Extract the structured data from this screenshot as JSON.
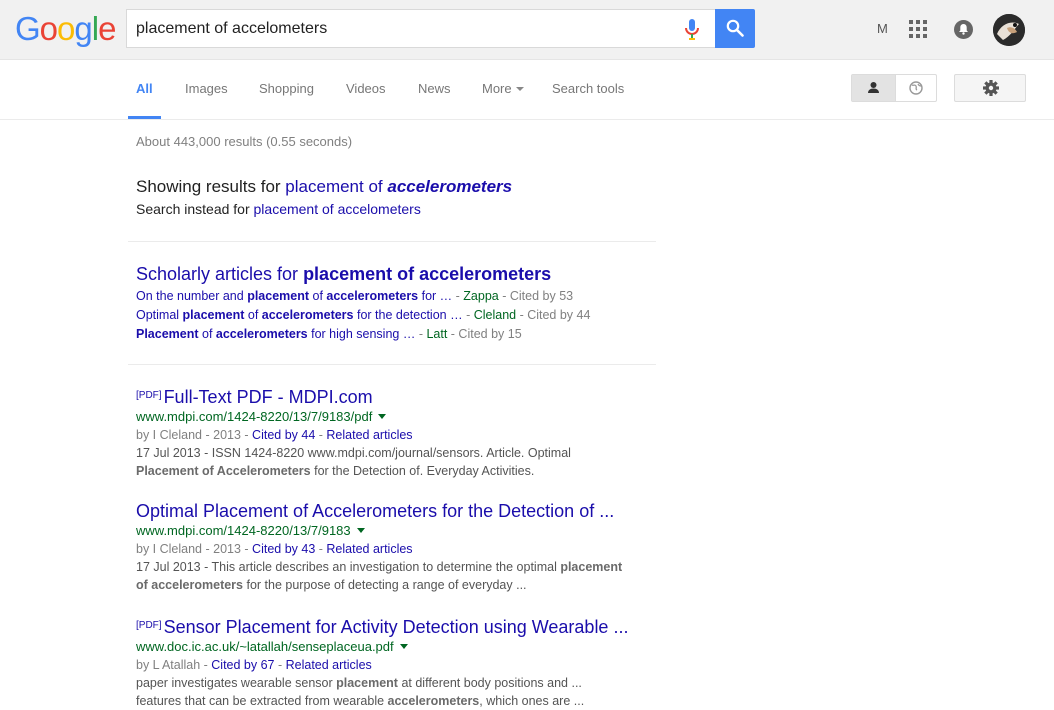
{
  "header": {
    "logo_letters": [
      {
        "ch": "G",
        "color": "#4285f4"
      },
      {
        "ch": "o",
        "color": "#ea4335"
      },
      {
        "ch": "o",
        "color": "#fbbc05"
      },
      {
        "ch": "g",
        "color": "#4285f4"
      },
      {
        "ch": "l",
        "color": "#34a853"
      },
      {
        "ch": "e",
        "color": "#ea4335"
      }
    ],
    "search_value": "placement of accelometers",
    "user_letter": "M"
  },
  "tabs": [
    {
      "label": "All",
      "active": true
    },
    {
      "label": "Images"
    },
    {
      "label": "Shopping"
    },
    {
      "label": "Videos"
    },
    {
      "label": "News"
    },
    {
      "label": "More"
    },
    {
      "label": "Search tools"
    }
  ],
  "stats": "About 443,000 results (0.55 seconds)",
  "correction": {
    "showing_prefix": "Showing results for ",
    "showing_plain": "placement of ",
    "showing_bold": "accelerometers",
    "instead_prefix": "Search instead for ",
    "instead_link": "placement of accelometers"
  },
  "scholarly": {
    "title_prefix": "Scholarly articles for ",
    "title_bold": "placement of accelerometers",
    "items": [
      {
        "parts": [
          [
            "On the number and ",
            false
          ],
          [
            "placement",
            true
          ],
          [
            " of ",
            false
          ],
          [
            "accelerometers",
            true
          ],
          [
            " for …",
            false
          ]
        ],
        "author": "Zappa",
        "cited": "Cited by 53"
      },
      {
        "parts": [
          [
            "Optimal ",
            false
          ],
          [
            "placement",
            true
          ],
          [
            " of ",
            false
          ],
          [
            "accelerometers",
            true
          ],
          [
            " for the detection …",
            false
          ]
        ],
        "author": "Cleland",
        "cited": "Cited by 44"
      },
      {
        "parts": [
          [
            "Placement",
            true
          ],
          [
            " of ",
            false
          ],
          [
            "accelerometers",
            true
          ],
          [
            " for high sensing …",
            false
          ]
        ],
        "author": "Latt",
        "cited": "Cited by 15"
      }
    ]
  },
  "results": [
    {
      "pdf": "[PDF]",
      "title": "Full-Text PDF - MDPI.com",
      "url": "www.mdpi.com/1424-8220/13/7/9183/pdf",
      "meta_prefix": "by I Cleland - 2013 - ",
      "cited": "Cited by 44",
      "related": "Related articles",
      "snippet1": [
        [
          "17 Jul 2013 - ",
          false
        ],
        [
          "ISSN 1424-8220 www.mdpi.com/journal/sensors. Article. Optimal",
          false
        ]
      ],
      "snippet2": [
        [
          "Placement of Accelerometers",
          true
        ],
        [
          " for the Detection of. Everyday Activities.",
          false
        ]
      ]
    },
    {
      "pdf": "",
      "title": "Optimal Placement of Accelerometers for the Detection of ...",
      "url": "www.mdpi.com/1424-8220/13/7/9183",
      "meta_prefix": "by I Cleland - 2013 - ",
      "cited": "Cited by 43",
      "related": "Related articles",
      "snippet1": [
        [
          "17 Jul 2013 - ",
          false
        ],
        [
          "This article describes an investigation to determine the optimal ",
          false
        ],
        [
          "placement",
          true
        ]
      ],
      "snippet2": [
        [
          "of accelerometers",
          true
        ],
        [
          " for the purpose of detecting a range of everyday ...",
          false
        ]
      ]
    },
    {
      "pdf": "[PDF]",
      "title": "Sensor Placement for Activity Detection using Wearable ...",
      "url": "www.doc.ic.ac.uk/~latallah/senseplaceua.pdf",
      "meta_prefix": "by L Atallah - ",
      "cited": "Cited by 67",
      "related": "Related articles",
      "snippet1": [
        [
          "paper investigates wearable sensor ",
          false
        ],
        [
          "placement",
          true
        ],
        [
          " at different body positions and ...",
          false
        ]
      ],
      "snippet2": [
        [
          "features that can be extracted from wearable ",
          false
        ],
        [
          "accelerometers",
          true
        ],
        [
          ", which ones are  ...",
          false
        ]
      ]
    }
  ],
  "colors": {
    "accent": "#4285f4",
    "link": "#1a0dab",
    "url_green": "#006621"
  }
}
